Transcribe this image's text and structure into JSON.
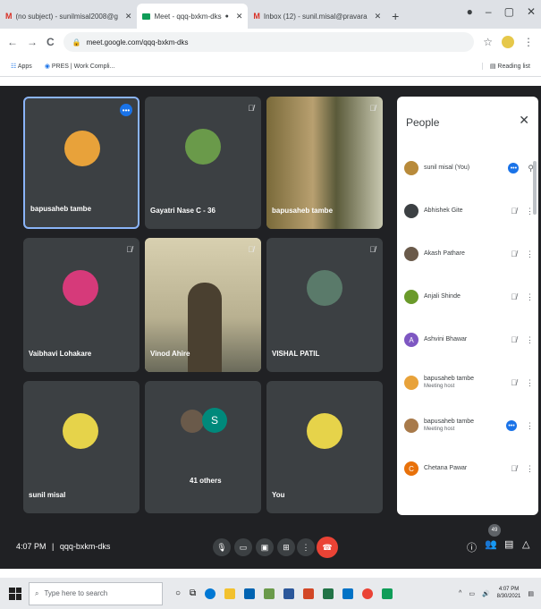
{
  "browser": {
    "tabs": [
      {
        "label": "(no subject) - sunilmisal2008@g",
        "color": "#d93025",
        "icon": "gmail-icon"
      },
      {
        "label": "Meet - qqq-bxkm-dks",
        "color": "#0f9d58",
        "icon": "meet-icon"
      },
      {
        "label": "Inbox (12) - sunil.misal@pravara",
        "color": "#d93025",
        "icon": "gmail-icon"
      }
    ],
    "url": "meet.google.com/qqq-bxkm-dks",
    "bookmarks": {
      "apps": "Apps",
      "item1": "PRES | Work Compli...",
      "reading_list": "Reading list"
    }
  },
  "tiles": [
    {
      "name": "bapusaheb tambe",
      "avatar_color": "#e8a23a"
    },
    {
      "name": "Gayatri Nase C - 36",
      "avatar_color": "#6a9a4a"
    },
    {
      "name": "bapusaheb tambe",
      "avatar_color": "#5a6a3a"
    },
    {
      "name": "Vaibhavi Lohakare",
      "avatar_color": "#d63a7a"
    },
    {
      "name": "Vinod Ahire",
      "avatar_color": "#8a7a5a"
    },
    {
      "name": "VISHAL PATIL",
      "avatar_color": "#5a7a6a"
    },
    {
      "name": "sunil misal",
      "avatar_color": "#e6d34a"
    },
    {
      "name": "41 others",
      "avatar_color": "#00897b",
      "avatar_letter": "S"
    },
    {
      "name": "You",
      "avatar_color": "#e6d34a"
    }
  ],
  "people": {
    "title": "People",
    "list": [
      {
        "name": "sunil misal (You)",
        "sub": "",
        "color": "#b88a3a",
        "letter": ""
      },
      {
        "name": "Abhishek Gite",
        "sub": "",
        "color": "#3c4043",
        "letter": ""
      },
      {
        "name": "Akash Pathare",
        "sub": "",
        "color": "#6a5a4a",
        "letter": ""
      },
      {
        "name": "Anjali Shinde",
        "sub": "",
        "color": "#6a9a2a",
        "letter": ""
      },
      {
        "name": "Ashvini Bhawar",
        "sub": "",
        "color": "#7e57c2",
        "letter": "A"
      },
      {
        "name": "bapusaheb tambe",
        "sub": "Meeting host",
        "color": "#e8a23a",
        "letter": ""
      },
      {
        "name": "bapusaheb tambe",
        "sub": "Meeting host",
        "color": "#a87a4a",
        "letter": ""
      },
      {
        "name": "Chetana Pawar",
        "sub": "",
        "color": "#e8710a",
        "letter": "C"
      }
    ]
  },
  "controls": {
    "time": "4:07 PM",
    "separator": "|",
    "code": "qqq-bxkm-dks",
    "participant_count": "49"
  },
  "taskbar": {
    "search_placeholder": "Type here to search",
    "time": "4:07 PM",
    "date": "8/30/2021"
  }
}
